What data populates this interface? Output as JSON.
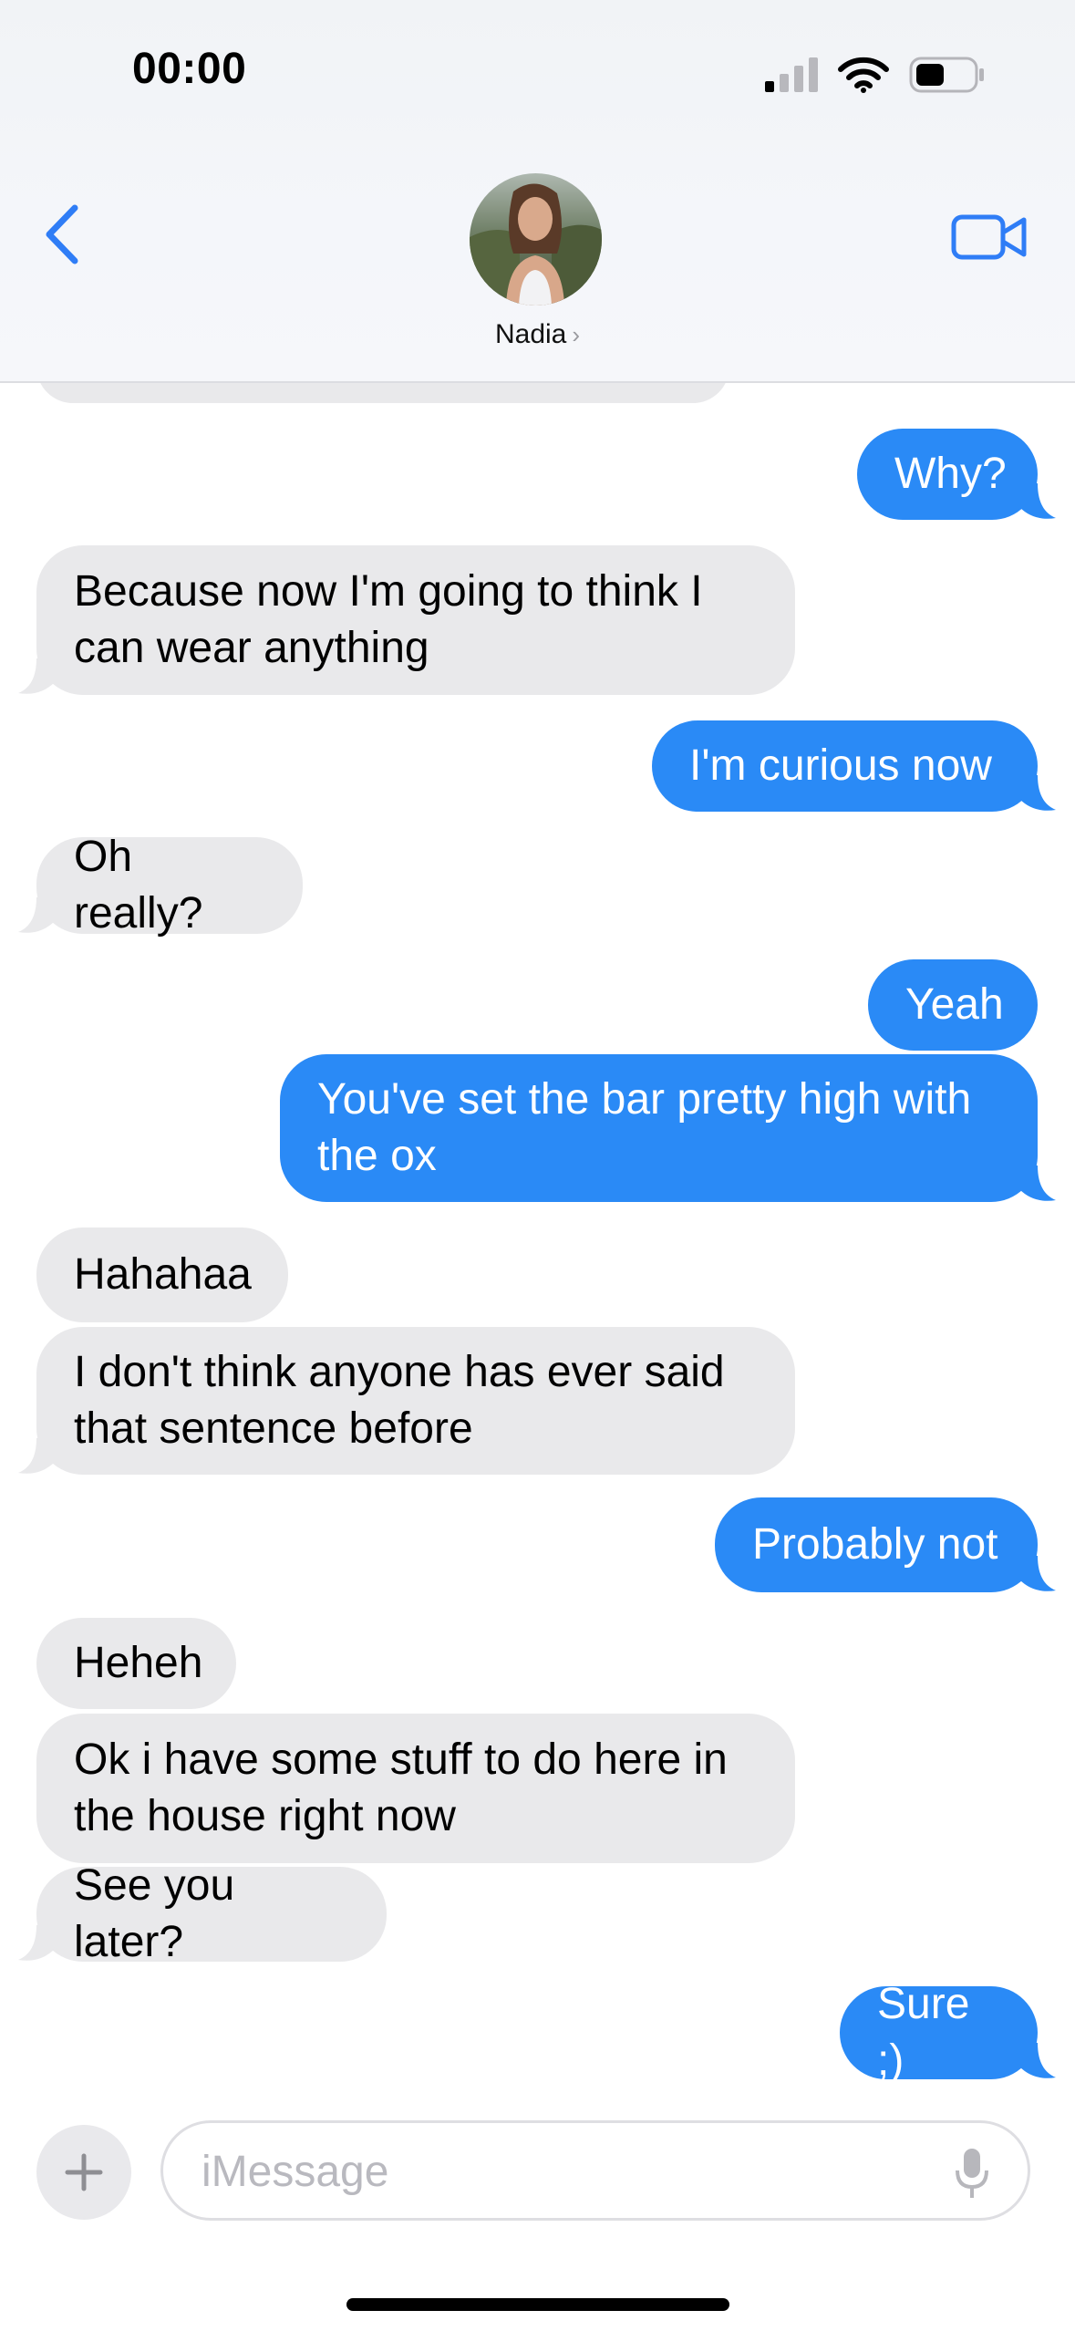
{
  "status_bar": {
    "time": "00:00"
  },
  "header": {
    "contact_name": "Nadia",
    "contact_chevron": "›"
  },
  "messages": [
    {
      "side": "out",
      "text": "Why?"
    },
    {
      "side": "in",
      "text": "Because now I'm going to think I\ncan wear anything"
    },
    {
      "side": "out",
      "text": "I'm curious now"
    },
    {
      "side": "in",
      "text": "Oh really?"
    },
    {
      "side": "out",
      "text": "Yeah"
    },
    {
      "side": "out",
      "text": "You've set the bar pretty high with\nthe ox"
    },
    {
      "side": "in",
      "text": "Hahahaa"
    },
    {
      "side": "in",
      "text": "I don't think anyone has ever said\nthat sentence before"
    },
    {
      "side": "out",
      "text": "Probably not"
    },
    {
      "side": "in",
      "text": "Heheh"
    },
    {
      "side": "in",
      "text": "Ok i have some stuff to do here in\nthe house right now"
    },
    {
      "side": "in",
      "text": "See you later?"
    },
    {
      "side": "out",
      "text": "Sure ;)"
    }
  ],
  "composer": {
    "placeholder": "iMessage"
  },
  "colors": {
    "outgoing": "#2a8af6",
    "incoming": "#e9e9eb",
    "accent": "#2f7df6"
  },
  "icons": [
    "back-chevron-icon",
    "video-call-icon",
    "plus-icon",
    "microphone-icon",
    "signal-icon",
    "wifi-icon",
    "battery-icon"
  ]
}
